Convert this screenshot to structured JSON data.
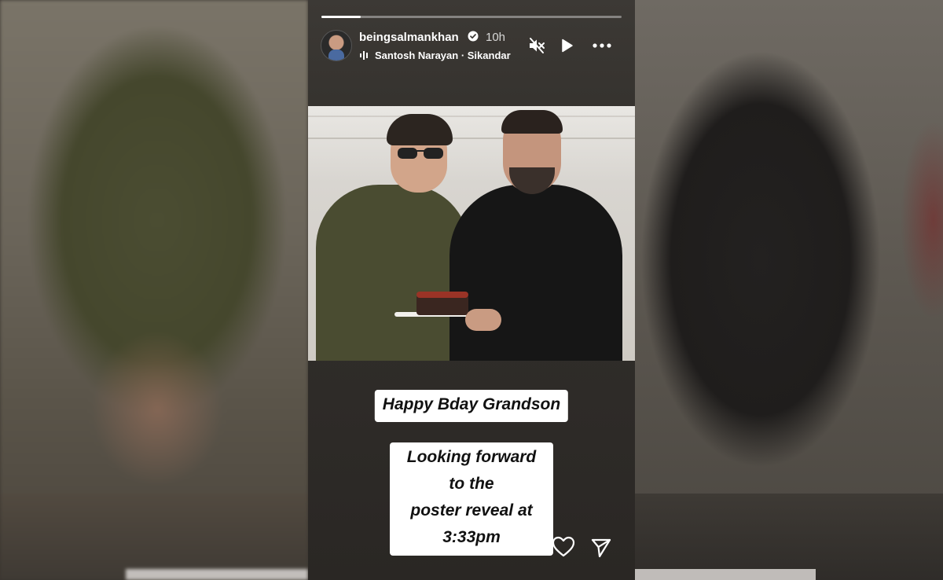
{
  "story": {
    "username": "beingsalmankhan",
    "time_ago": "10h",
    "song": "Santosh Narayan · Sikandar",
    "progress": 0.13,
    "captions": [
      "Happy Bday Grandson",
      "Looking forward to the\nposter reveal at 3:33pm"
    ]
  },
  "icons": {
    "verified": "verified-badge-icon",
    "music": "music-bars-icon",
    "mute": "muted-speaker-icon",
    "play": "play-icon",
    "more": "more-options-icon",
    "like": "heart-icon",
    "share": "send-icon"
  },
  "colors": {
    "caption_bg": "#ffffff",
    "caption_text": "#111111",
    "panel_bg": "#35322e"
  }
}
